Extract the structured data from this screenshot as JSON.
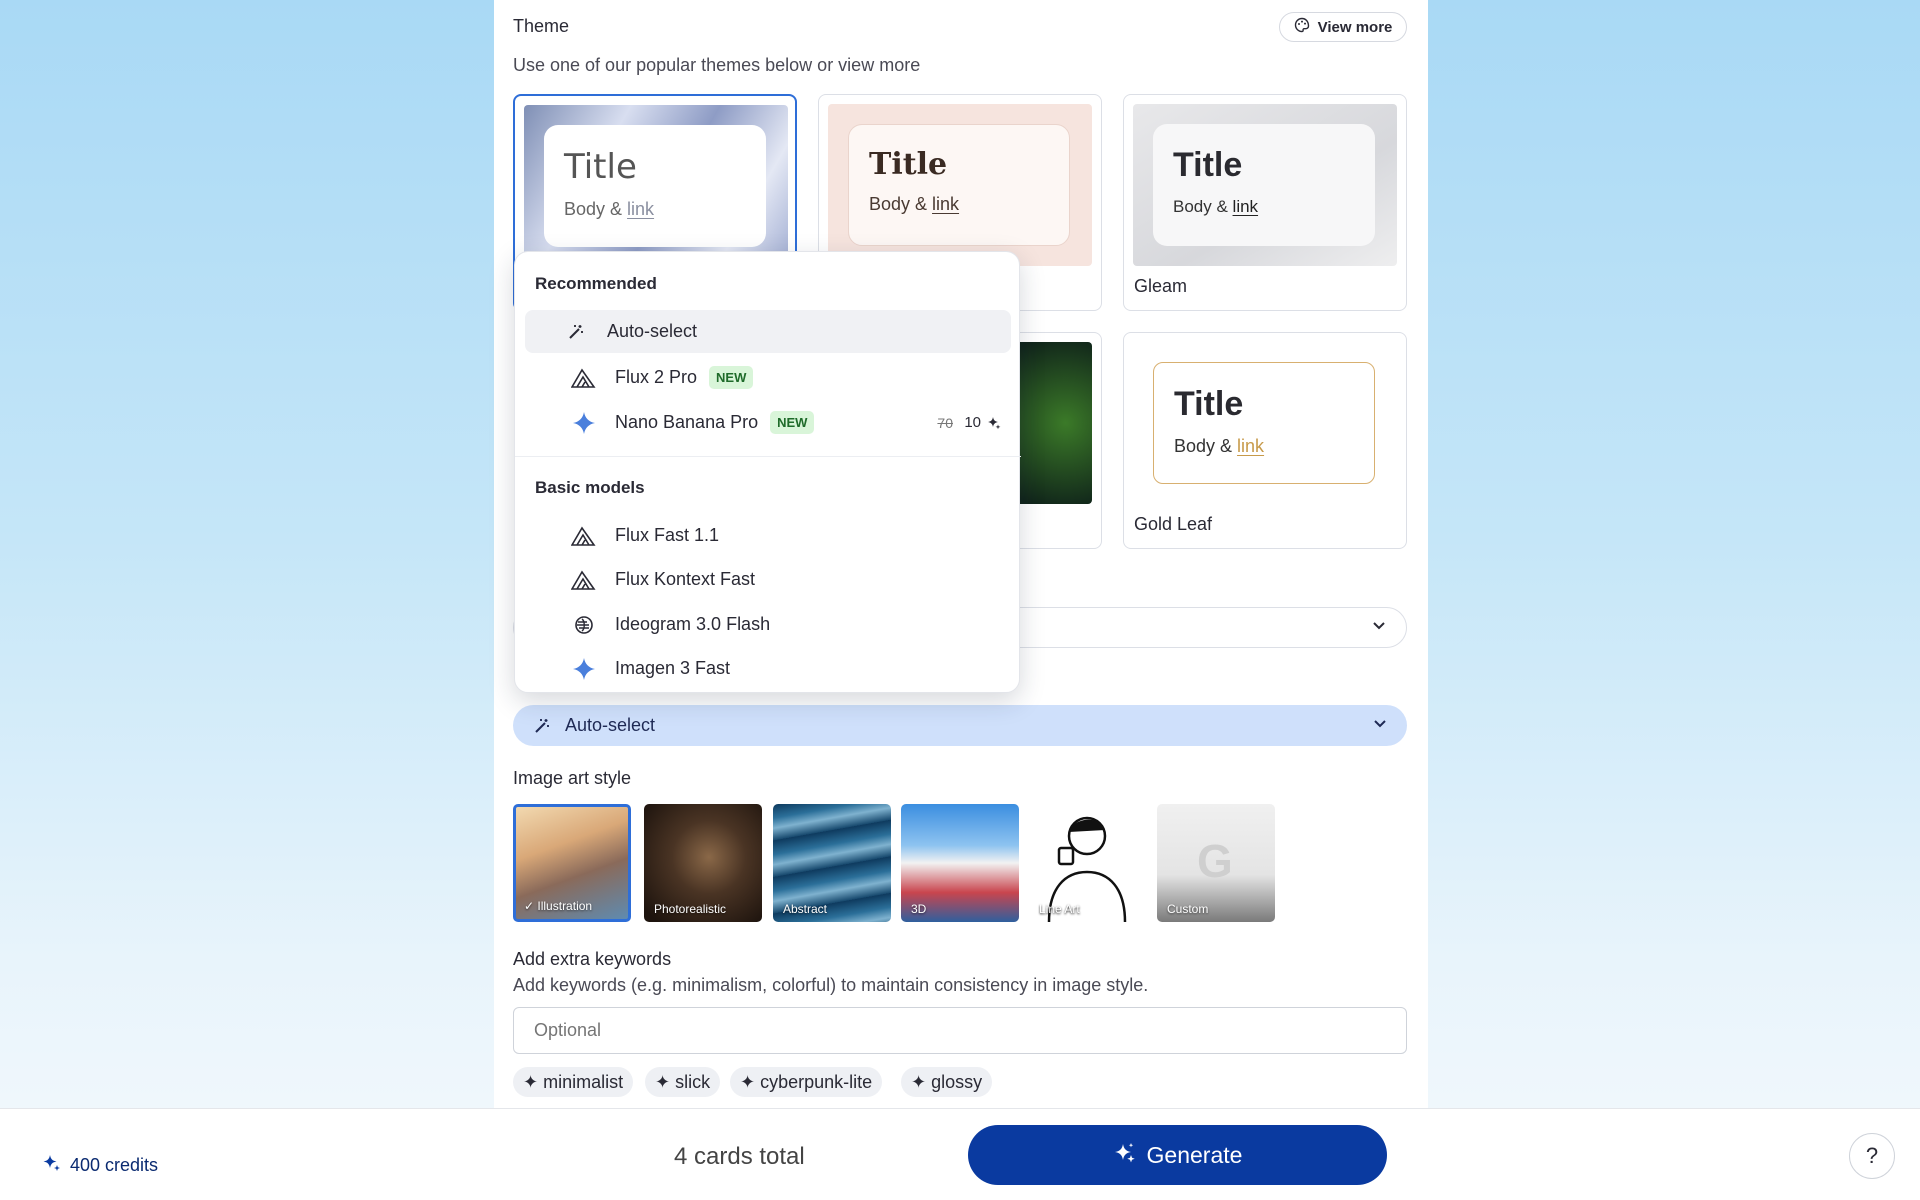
{
  "theme": {
    "title": "Theme",
    "subtitle": "Use one of our popular themes below or view more",
    "view_more": "View more",
    "cards": [
      {
        "title": "Title",
        "body": "Body & ",
        "link": "link",
        "name": ""
      },
      {
        "title": "Title",
        "body": "Body & ",
        "link": "link",
        "name": ""
      },
      {
        "title": "Title",
        "body": "Body & ",
        "link": "link",
        "name": "Gleam"
      },
      {
        "title": "Title",
        "body": "Body & ",
        "link": "link",
        "name": "Gold Leaf"
      }
    ]
  },
  "model_dropdown": {
    "recommended_heading": "Recommended",
    "recommended": [
      {
        "label": "Auto-select",
        "icon": "magic-wand-icon"
      },
      {
        "label": "Flux 2 Pro",
        "badge": "NEW",
        "icon": "flux-triangle-icon"
      },
      {
        "label": "Nano Banana Pro",
        "badge": "NEW",
        "icon": "gemini-sparkle-icon",
        "old_price": "70",
        "price": "10"
      }
    ],
    "basic_heading": "Basic models",
    "basic": [
      {
        "label": "Flux Fast 1.1",
        "icon": "flux-triangle-icon"
      },
      {
        "label": "Flux Kontext Fast",
        "icon": "flux-triangle-icon"
      },
      {
        "label": "Ideogram 3.0 Flash",
        "icon": "ideogram-icon"
      },
      {
        "label": "Imagen 3 Fast",
        "icon": "gemini-sparkle-icon"
      }
    ]
  },
  "model_select": {
    "value": "Auto-select"
  },
  "art_style": {
    "title": "Image art style",
    "styles": [
      {
        "label": "Illustration",
        "selected": true
      },
      {
        "label": "Photorealistic"
      },
      {
        "label": "Abstract"
      },
      {
        "label": "3D"
      },
      {
        "label": "Line Art"
      },
      {
        "label": "Custom"
      }
    ]
  },
  "keywords": {
    "title": "Add extra keywords",
    "subtitle": "Add keywords (e.g. minimalism, colorful) to maintain consistency in image style.",
    "placeholder": "Optional",
    "chips": [
      "minimalist",
      "slick",
      "cyberpunk-lite",
      "glossy"
    ]
  },
  "footer": {
    "credits": "400 credits",
    "cards_total": "4 cards total",
    "generate": "Generate",
    "help": "?"
  },
  "colors": {
    "accent": "#0a3aa0",
    "selected_border": "#2e6ed8",
    "select_bg": "#cfe0fb"
  }
}
